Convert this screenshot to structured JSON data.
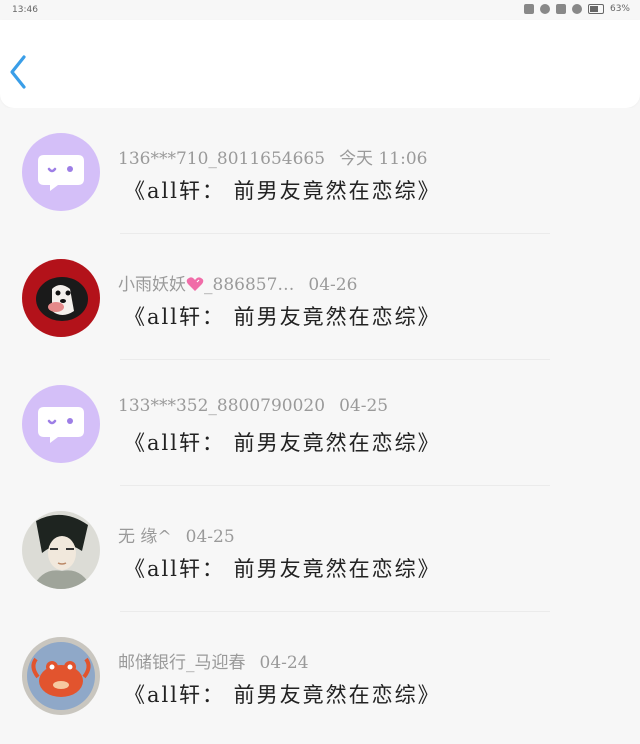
{
  "status_bar": {
    "time": "13:46",
    "battery": "63%"
  },
  "nav": {
    "back_icon": "chevron-left-icon",
    "accent": "#3a9ee8"
  },
  "messages": [
    {
      "sender": "136***710_8011654665",
      "date": "今天 11:06",
      "text": "《all轩： 前男友竟然在恋综》",
      "avatar": "default-chat-bubble-avatar"
    },
    {
      "sender": "小雨妖妖",
      "sender_suffix": "_886857…",
      "date": "04-26",
      "text": "《all轩： 前男友竟然在恋综》",
      "avatar": "dog-photo-avatar"
    },
    {
      "sender": "133***352_8800790020",
      "date": "04-25",
      "text": "《all轩： 前男友竟然在恋综》",
      "avatar": "default-chat-bubble-avatar"
    },
    {
      "sender": "无 缘^",
      "date": "04-25",
      "text": "《all轩： 前男友竟然在恋综》",
      "avatar": "anime-character-avatar"
    },
    {
      "sender": "邮储银行_马迎春",
      "date": "04-24",
      "text": "《all轩： 前男友竟然在恋综》",
      "avatar": "cartoon-crab-avatar"
    }
  ]
}
